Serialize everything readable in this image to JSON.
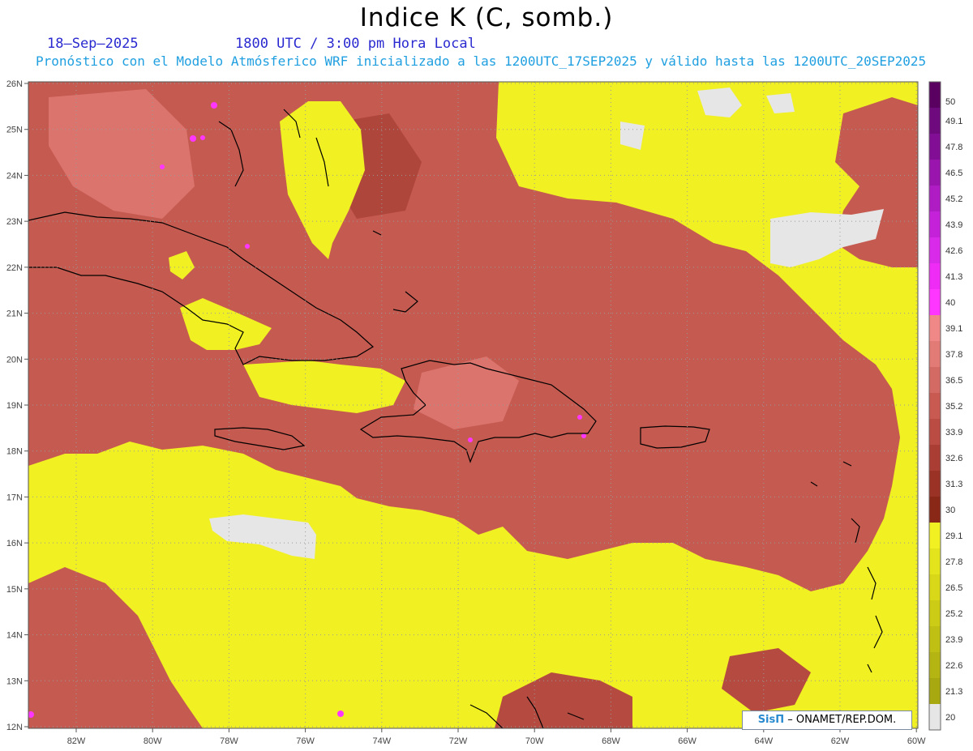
{
  "header": {
    "title": "Indice K (C, somb.)",
    "date": "18–Sep–2025",
    "time": "1800 UTC / 3:00 pm Hora Local",
    "subtitle": "Pronóstico con el Modelo Atmósferico WRF inicializado a las 1200UTC_17SEP2025 y válido hasta las  1200UTC_20SEP2025"
  },
  "map": {
    "lat_labels": [
      "26N",
      "25N",
      "24N",
      "23N",
      "22N",
      "21N",
      "20N",
      "19N",
      "18N",
      "17N",
      "16N",
      "15N",
      "14N",
      "13N",
      "12N"
    ],
    "lon_labels": [
      "82W",
      "80W",
      "78W",
      "76W",
      "74W",
      "72W",
      "70W",
      "68W",
      "66W",
      "64W",
      "62W",
      "60W"
    ]
  },
  "colorbar": {
    "labels": [
      "50",
      "49.1",
      "47.8",
      "46.5",
      "45.2",
      "43.9",
      "42.6",
      "41.3",
      "40",
      "39.1",
      "37.8",
      "36.5",
      "35.2",
      "33.9",
      "32.6",
      "31.3",
      "30",
      "29.1",
      "27.8",
      "26.5",
      "25.2",
      "23.9",
      "22.6",
      "21.3",
      "20"
    ],
    "colors": [
      "#5a0060",
      "#6e0a7e",
      "#820e96",
      "#9a14ae",
      "#b01cc4",
      "#c422d8",
      "#d82ae8",
      "#ee2cf6",
      "#ff36ff",
      "#f08888",
      "#e27a76",
      "#d46a64",
      "#c85a52",
      "#ba4c44",
      "#aa3e34",
      "#9a3226",
      "#8a2818",
      "#f0f022",
      "#e4e41c",
      "#d8d818",
      "#cccc16",
      "#c0c014",
      "#b4b412",
      "#a8a810",
      "#e6e6e6"
    ]
  },
  "credit": {
    "sis": "SisΠ",
    "org": "– ONAMET/REP.DOM."
  }
}
